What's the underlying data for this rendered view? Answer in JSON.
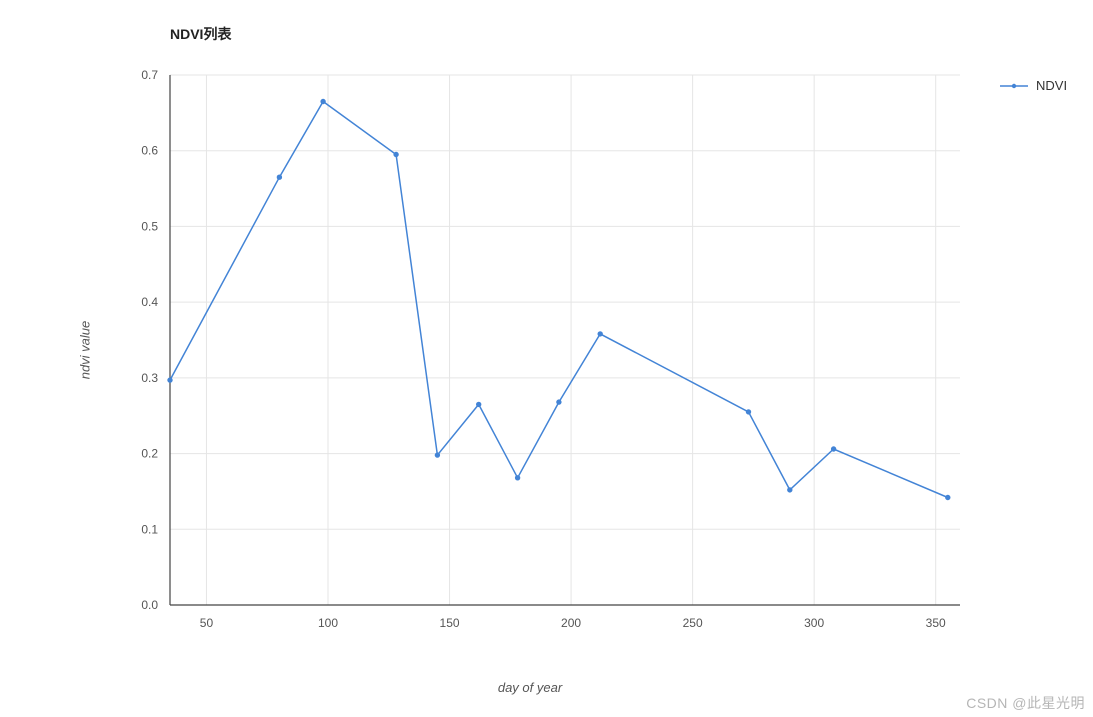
{
  "chart_data": {
    "type": "line",
    "title": "NDVI列表",
    "xlabel": "day of year",
    "ylabel": "ndvi value",
    "xlim": [
      35,
      360
    ],
    "ylim": [
      0.0,
      0.7
    ],
    "x_ticks": [
      50,
      100,
      150,
      200,
      250,
      300,
      350
    ],
    "y_ticks": [
      0.0,
      0.1,
      0.2,
      0.3,
      0.4,
      0.5,
      0.6,
      0.7
    ],
    "series": [
      {
        "name": "NDVI",
        "color": "#4384d6",
        "x": [
          35,
          80,
          98,
          128,
          145,
          162,
          178,
          195,
          212,
          273,
          290,
          308,
          355
        ],
        "values": [
          0.297,
          0.565,
          0.665,
          0.595,
          0.198,
          0.265,
          0.168,
          0.268,
          0.358,
          0.255,
          0.152,
          0.206,
          0.142
        ]
      }
    ],
    "legend": {
      "entries": [
        "NDVI"
      ]
    }
  },
  "watermark": "CSDN @此星光明"
}
